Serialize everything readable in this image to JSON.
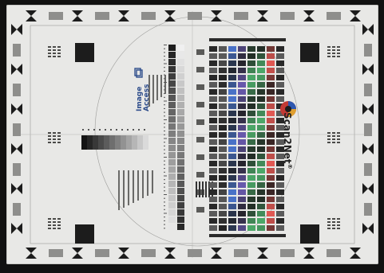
{
  "target": {
    "brand_left": "Image Access",
    "brand_right": "Scan2Net",
    "trademark": "®",
    "logo_letters": "S2N",
    "colors": {
      "paper": "#e8e8e6",
      "ink": "#1c1c1c",
      "blue": "#2d57b0",
      "green": "#2e8a4a",
      "red": "#c23a35",
      "purple": "#4b3c91",
      "brand_blue": "#2f4e8c"
    }
  }
}
